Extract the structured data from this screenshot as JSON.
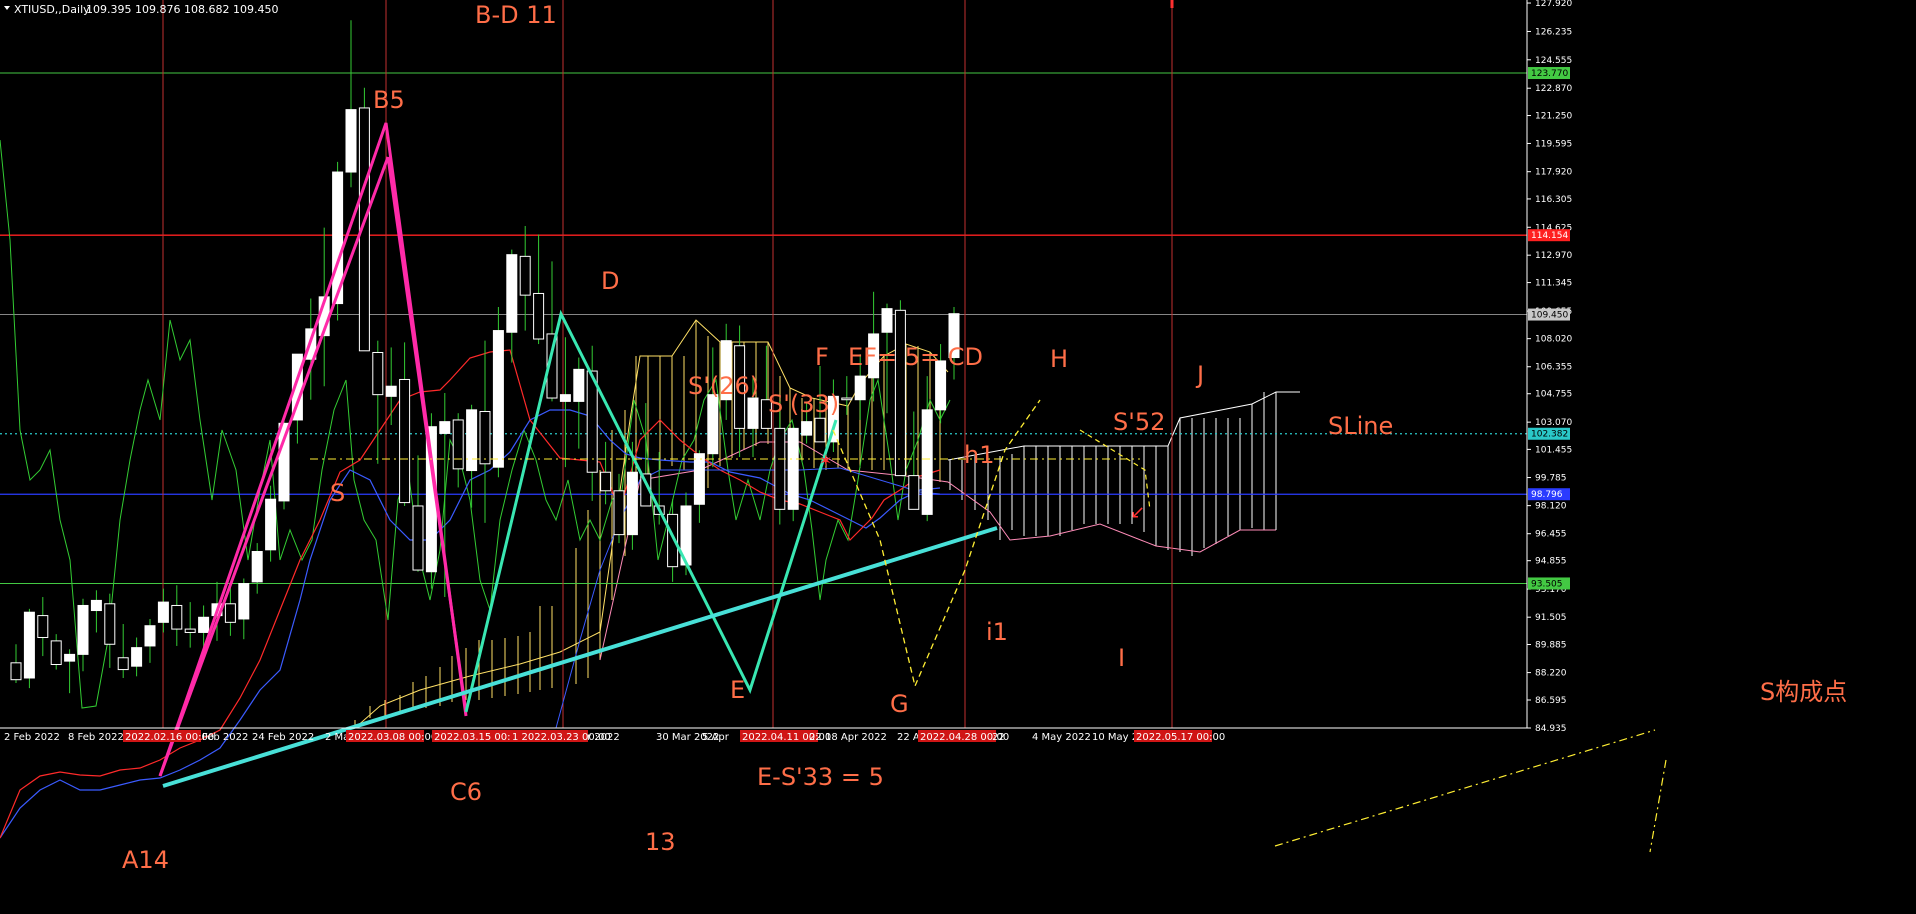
{
  "header": {
    "symbol": "XTIUSD,,Daily",
    "ohlc": "109.395 109.876 108.682 109.450",
    "menu_icon": "triangle-down-icon"
  },
  "colors": {
    "background": "#000000",
    "bull_candle": "#ffffff",
    "bear_candle": "#000000",
    "wick": "#33cc33",
    "kijun": "#ff2a2a",
    "tenkan": "#3b5bff",
    "chikou": "#33cc33",
    "cloud_bull": "#ffe066",
    "cloud_bear": "#ffffff",
    "senkou_a": "#ffe066",
    "senkou_b": "#ff8cb8",
    "annotation": "#ff6e48",
    "vline": "#c23030",
    "grid_blue": "#2a3bff",
    "hline_red": "#ff2020",
    "hline_green": "#43c943",
    "trend_cyan": "#48e0d8",
    "zigzag_magenta": "#ff2aa8",
    "zigzag_green": "#39e7b2",
    "yellow_dash": "#ffee33"
  },
  "chart_data": {
    "type": "candlestick",
    "symbol": "XTIUSD",
    "timeframe": "Daily",
    "ylim": [
      84.935,
      128.1
    ],
    "price_ticks": [
      "127.920",
      "126.235",
      "124.555",
      "122.870",
      "121.250",
      "119.595",
      "117.920",
      "116.305",
      "114.625",
      "112.970",
      "111.345",
      "109.655",
      "108.020",
      "106.355",
      "104.755",
      "103.070",
      "101.455",
      "99.785",
      "98.120",
      "96.455",
      "94.855",
      "93.170",
      "91.505",
      "89.885",
      "88.220",
      "86.595",
      "84.935"
    ],
    "date_ticks": [
      "2 Feb 2022",
      "8 Feb 2022",
      "2022.02.16 00:00",
      "Feb 2022",
      "24 Feb 2022",
      "2 Mar",
      "2022.03.08 00:00",
      "2022.03.15 00:00",
      "1 2022.03.23 00:00",
      "r 2022",
      "30 Mar 2022",
      "5 Apr",
      "2022.04.11 00:00",
      "22",
      "18 Apr 2022",
      "22 Ap",
      "2022.04.28 00:00",
      "22",
      "4 May 2022",
      "10 May 2",
      "2022.05.17 00:00"
    ],
    "date_ticks_highlighted": [
      false,
      false,
      true,
      false,
      false,
      false,
      true,
      true,
      true,
      false,
      false,
      false,
      true,
      false,
      false,
      false,
      true,
      false,
      false,
      false,
      true
    ],
    "candles": [
      [
        88.8,
        89.9,
        87.6,
        87.8
      ],
      [
        87.9,
        92.0,
        87.3,
        91.8
      ],
      [
        91.6,
        92.7,
        89.2,
        90.3
      ],
      [
        90.1,
        90.5,
        88.4,
        88.7
      ],
      [
        88.9,
        89.6,
        87.0,
        89.3
      ],
      [
        89.3,
        92.6,
        88.3,
        92.2
      ],
      [
        91.9,
        93.1,
        90.6,
        92.5
      ],
      [
        92.3,
        92.9,
        88.5,
        89.9
      ],
      [
        89.1,
        91.1,
        87.9,
        88.4
      ],
      [
        88.6,
        90.3,
        88.0,
        89.7
      ],
      [
        89.8,
        91.4,
        88.8,
        91.0
      ],
      [
        91.2,
        93.2,
        90.6,
        92.4
      ],
      [
        92.2,
        93.4,
        89.8,
        90.8
      ],
      [
        90.8,
        92.4,
        89.7,
        90.6
      ],
      [
        90.6,
        92.2,
        89.1,
        91.5
      ],
      [
        91.6,
        93.6,
        90.1,
        92.3
      ],
      [
        92.3,
        93.3,
        90.4,
        91.2
      ],
      [
        91.4,
        93.8,
        90.2,
        93.5
      ],
      [
        93.6,
        95.9,
        92.9,
        95.4
      ],
      [
        95.5,
        99.3,
        94.8,
        98.5
      ],
      [
        98.4,
        103.4,
        97.9,
        103.0
      ],
      [
        103.2,
        106.6,
        101.8,
        107.1
      ],
      [
        106.8,
        110.4,
        104.4,
        108.6
      ],
      [
        108.2,
        114.6,
        105.2,
        110.5
      ],
      [
        110.1,
        118.5,
        109.1,
        117.9
      ],
      [
        117.9,
        126.9,
        117.0,
        121.6
      ],
      [
        121.7,
        122.9,
        111.3,
        107.3
      ],
      [
        107.2,
        107.9,
        100.6,
        104.7
      ],
      [
        104.6,
        107.5,
        102.9,
        105.2
      ],
      [
        105.6,
        107.8,
        98.1,
        98.3
      ],
      [
        98.1,
        101.1,
        94.2,
        94.3
      ],
      [
        94.2,
        103.6,
        93.2,
        102.8
      ],
      [
        102.4,
        104.8,
        92.7,
        103.1
      ],
      [
        103.2,
        103.6,
        99.2,
        100.3
      ],
      [
        100.2,
        104.1,
        98.0,
        103.8
      ],
      [
        103.7,
        107.9,
        97.1,
        100.6
      ],
      [
        100.4,
        109.9,
        99.8,
        108.5
      ],
      [
        108.4,
        113.3,
        106.6,
        113.0
      ],
      [
        112.9,
        114.7,
        108.5,
        110.6
      ],
      [
        110.7,
        114.2,
        107.7,
        108.0
      ],
      [
        108.3,
        112.6,
        104.3,
        104.5
      ],
      [
        104.3,
        108.1,
        100.4,
        104.7
      ],
      [
        104.3,
        106.9,
        101.5,
        106.2
      ],
      [
        106.1,
        107.6,
        98.4,
        100.1
      ],
      [
        100.1,
        101.9,
        98.2,
        99.0
      ],
      [
        99.0,
        100.0,
        95.9,
        96.4
      ],
      [
        96.4,
        101.9,
        95.5,
        100.1
      ],
      [
        100.0,
        104.2,
        98.1,
        98.1
      ],
      [
        98.1,
        101.3,
        97.0,
        97.6
      ],
      [
        97.6,
        98.5,
        93.6,
        94.5
      ],
      [
        94.6,
        98.9,
        94.0,
        98.1
      ],
      [
        98.2,
        101.4,
        97.1,
        101.2
      ],
      [
        101.2,
        107.5,
        100.4,
        104.7
      ],
      [
        104.4,
        108.9,
        103.2,
        107.9
      ],
      [
        107.6,
        108.8,
        101.0,
        102.7
      ],
      [
        102.7,
        105.8,
        101.0,
        104.5
      ],
      [
        104.4,
        107.6,
        103.6,
        102.7
      ],
      [
        102.7,
        104.3,
        97.0,
        97.9
      ],
      [
        97.9,
        102.8,
        97.2,
        102.7
      ],
      [
        102.3,
        104.2,
        101.8,
        103.1
      ],
      [
        103.3,
        106.4,
        102.0,
        101.9
      ],
      [
        101.9,
        105.6,
        101.3,
        104.6
      ],
      [
        104.5,
        105.8,
        103.5,
        104.4
      ],
      [
        104.4,
        107.1,
        103.2,
        105.8
      ],
      [
        105.7,
        110.8,
        104.3,
        108.3
      ],
      [
        108.4,
        110.1,
        103.6,
        109.8
      ],
      [
        109.7,
        110.3,
        100.0,
        99.9
      ],
      [
        99.9,
        103.7,
        97.9,
        97.9
      ],
      [
        97.6,
        105.8,
        97.2,
        103.8
      ],
      [
        103.8,
        107.7,
        103.0,
        106.7
      ],
      [
        106.9,
        109.9,
        105.6,
        109.5
      ]
    ],
    "price_lines": [
      {
        "price": "123.770",
        "color": "#43c943",
        "text_color": "#000000"
      },
      {
        "price": "114.154",
        "color": "#ff2020",
        "text_color": "#ffffff"
      },
      {
        "price": "109.450",
        "color": "#c8c8c8",
        "text_color": "#000000"
      },
      {
        "price": "102.382",
        "color": "#2ac8c8",
        "text_color": "#000000"
      },
      {
        "price": "98.796",
        "color": "#2a3bff",
        "text_color": "#ffffff"
      },
      {
        "price": "93.505",
        "color": "#43c943",
        "text_color": "#000000"
      }
    ],
    "annotations": [
      {
        "text": "B-D 11",
        "color": "#ff6e48",
        "size": 24
      },
      {
        "text": "B5",
        "color": "#ff6e48",
        "size": 24
      },
      {
        "text": "D",
        "color": "#ff6e48",
        "size": 24
      },
      {
        "text": "F",
        "color": "#ff6e48",
        "size": 24
      },
      {
        "text": "EF= 5= CD",
        "color": "#ff6e48",
        "size": 24
      },
      {
        "text": "H",
        "color": "#ff6e48",
        "size": 24
      },
      {
        "text": "J",
        "color": "#ff6e48",
        "size": 24
      },
      {
        "text": "S'(26)",
        "color": "#ff6e48",
        "size": 24
      },
      {
        "text": "S'(33)",
        "color": "#ff6e48",
        "size": 24
      },
      {
        "text": "S'52",
        "color": "#ff6e48",
        "size": 24
      },
      {
        "text": "SLine",
        "color": "#ff6e48",
        "size": 24
      },
      {
        "text": "h1",
        "color": "#ff6e48",
        "size": 24
      },
      {
        "text": "S",
        "color": "#ff6e48",
        "size": 24
      },
      {
        "text": "i1",
        "color": "#ff6e48",
        "size": 24
      },
      {
        "text": "I",
        "color": "#ff6e48",
        "size": 24
      },
      {
        "text": "E",
        "color": "#ff6e48",
        "size": 24
      },
      {
        "text": "G",
        "color": "#ff6e48",
        "size": 24
      },
      {
        "text": "S构成点",
        "color": "#ff6e48",
        "size": 24
      },
      {
        "text": "C6",
        "color": "#ff6e48",
        "size": 24
      },
      {
        "text": "E-S'33 = 5",
        "color": "#ff6e48",
        "size": 24
      },
      {
        "text": "13",
        "color": "#ff6e48",
        "size": 24
      },
      {
        "text": "A14",
        "color": "#ff6e48",
        "size": 24
      }
    ]
  }
}
